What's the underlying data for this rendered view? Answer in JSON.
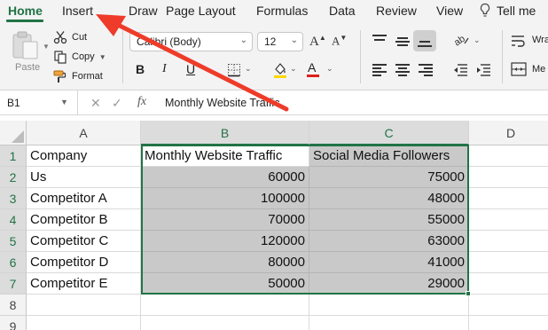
{
  "tabs": [
    "Home",
    "Insert",
    "Draw",
    "Page Layout",
    "Formulas",
    "Data",
    "Review",
    "View"
  ],
  "tell_me": "Tell me",
  "clipboard": {
    "paste": "Paste",
    "cut": "Cut",
    "copy": "Copy",
    "format": "Format"
  },
  "font": {
    "name": "Calibri (Body)",
    "size": "12"
  },
  "wrap_truncated": "Wra",
  "merge_truncated": "Me",
  "formula_bar": {
    "name_box": "B1",
    "fx": "fx",
    "content": "Monthly Website Traffic"
  },
  "grid": {
    "columns": [
      "A",
      "B",
      "C",
      "D"
    ],
    "rows": [
      "1",
      "2",
      "3",
      "4",
      "5",
      "6",
      "7",
      "8",
      "9"
    ],
    "header_row": [
      "Company",
      "Monthly Website Traffic",
      "Social Media Followers"
    ],
    "data": [
      [
        "Us",
        "60000",
        "75000"
      ],
      [
        "Competitor A",
        "100000",
        "48000"
      ],
      [
        "Competitor B",
        "70000",
        "55000"
      ],
      [
        "Competitor C",
        "120000",
        "63000"
      ],
      [
        "Competitor D",
        "80000",
        "41000"
      ],
      [
        "Competitor E",
        "50000",
        "29000"
      ]
    ]
  },
  "colors": {
    "accent_green": "#217346",
    "selection_fill": "#c9c9c9",
    "annotation_arrow": "#ee3b2a"
  },
  "icons": [
    "paste-icon",
    "scissors-icon",
    "copy-icon",
    "format-painter-icon",
    "lightbulb-icon",
    "fill-color-icon",
    "font-color-icon",
    "borders-icon",
    "orientation-icon",
    "wrap-text-icon",
    "merge-icon"
  ]
}
